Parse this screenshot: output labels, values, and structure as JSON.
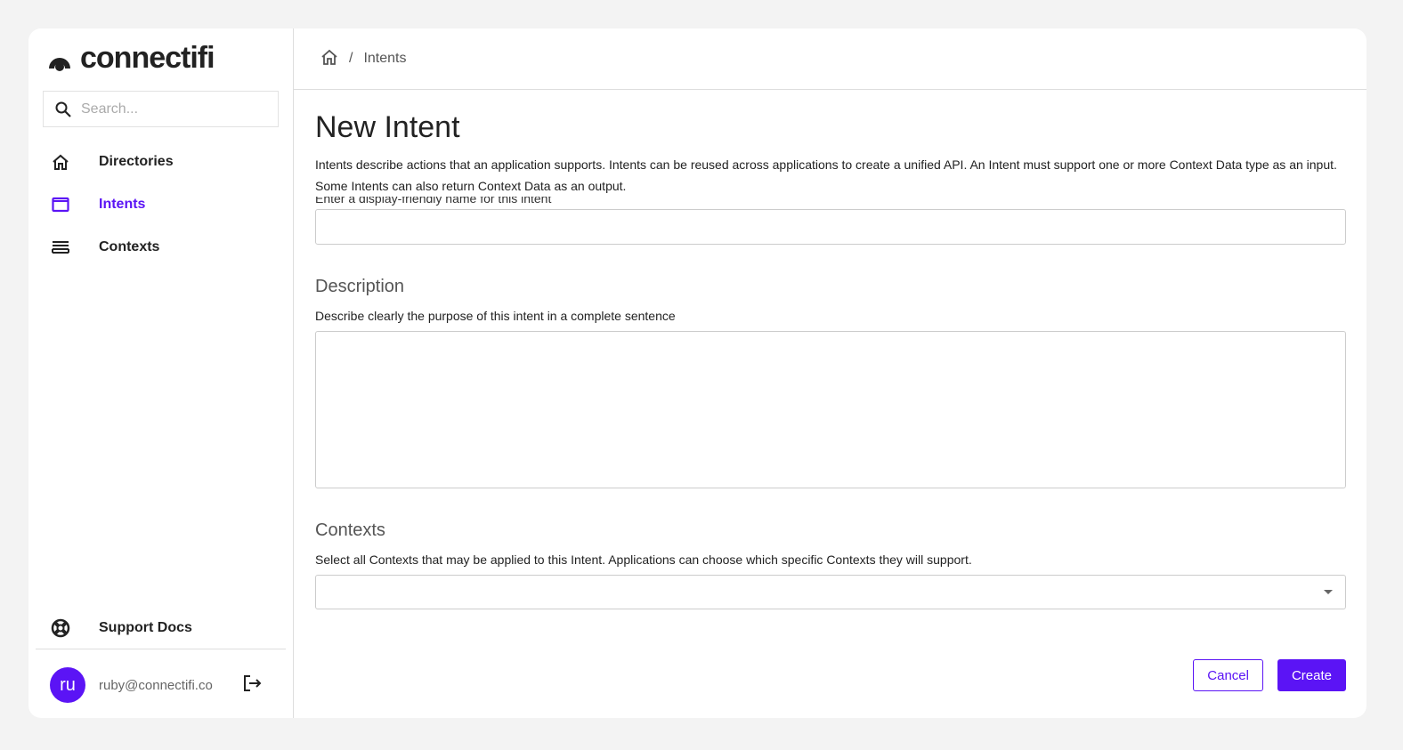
{
  "brand": {
    "name": "connectifi",
    "accent": "#5b14f5"
  },
  "search": {
    "placeholder": "Search..."
  },
  "sidebar": {
    "items": [
      {
        "label": "Directories",
        "icon": "home-icon"
      },
      {
        "label": "Intents",
        "icon": "window-icon",
        "active": true
      },
      {
        "label": "Contexts",
        "icon": "list-icon"
      }
    ],
    "support": {
      "label": "Support Docs",
      "icon": "lifebuoy-icon"
    }
  },
  "user": {
    "initials": "ru",
    "email": "ruby@connectifi.co"
  },
  "breadcrumb": {
    "separator": "/",
    "current": "Intents"
  },
  "page": {
    "title": "New Intent",
    "intro": "Intents describe actions that an application supports. Intents can be reused across applications to create a unified API. An Intent must support one or more Context Data type as an input. Some Intents can also return Context Data as an output.",
    "name_help": "Enter a display-friendly name for this intent",
    "name_value": "",
    "description_label": "Description",
    "description_help": "Describe clearly the purpose of this intent in a complete sentence",
    "description_value": "",
    "contexts_label": "Contexts",
    "contexts_help": "Select all Contexts that may be applied to this Intent. Applications can choose which specific Contexts they will support.",
    "contexts_value": ""
  },
  "actions": {
    "cancel": "Cancel",
    "create": "Create"
  }
}
